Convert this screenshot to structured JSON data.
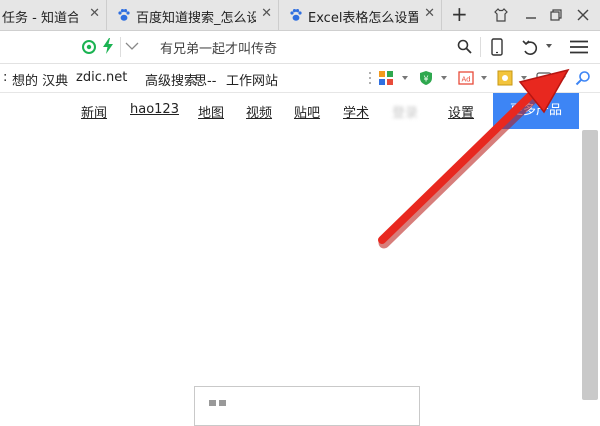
{
  "tabs": [
    {
      "title": "任务 - 知道合伙人",
      "close": "✕"
    },
    {
      "title": "百度知道搜索_怎么设置",
      "close": "✕"
    },
    {
      "title": "Excel表格怎么设置",
      "close": "✕"
    }
  ],
  "new_tab": "+",
  "address": {
    "query": "有兄弟一起才叫传奇"
  },
  "bookmarks": [
    "想的 汉典",
    "zdic.net",
    "高级搜索",
    "思--",
    "工作网站"
  ],
  "bookmarks_prefix": ":",
  "page": {
    "nav": [
      "新闻",
      "hao123",
      "地图",
      "视频",
      "贴吧",
      "学术",
      "登录",
      "设置"
    ],
    "more_button": "更多产品"
  },
  "colors": {
    "accent": "#3d85f5",
    "arrow": "#e8281f",
    "bolt": "#1bb352"
  }
}
